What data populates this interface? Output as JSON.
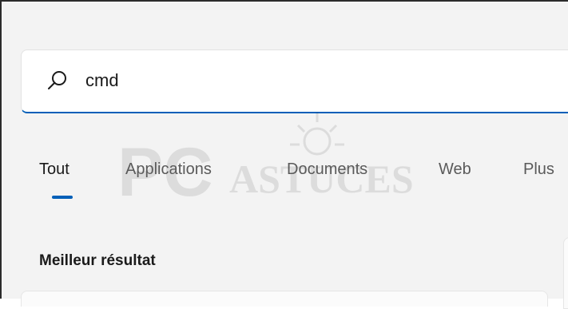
{
  "search": {
    "value": "cmd",
    "placeholder": ""
  },
  "tabs": [
    {
      "label": "Tout",
      "active": true
    },
    {
      "label": "Applications",
      "active": false
    },
    {
      "label": "Documents",
      "active": false
    },
    {
      "label": "Web",
      "active": false
    },
    {
      "label": "Plus",
      "active": false
    }
  ],
  "results": {
    "best_match_title": "Meilleur résultat"
  },
  "watermark": {
    "text_pc": "PC",
    "text_astuces": "ASTUCES",
    "icon": "sun-icon"
  },
  "icons": {
    "search": "search-icon"
  },
  "colors": {
    "accent": "#005fb8",
    "background": "#f3f3f3",
    "text": "#1a1a1a",
    "text_secondary": "#5a5a5a"
  }
}
